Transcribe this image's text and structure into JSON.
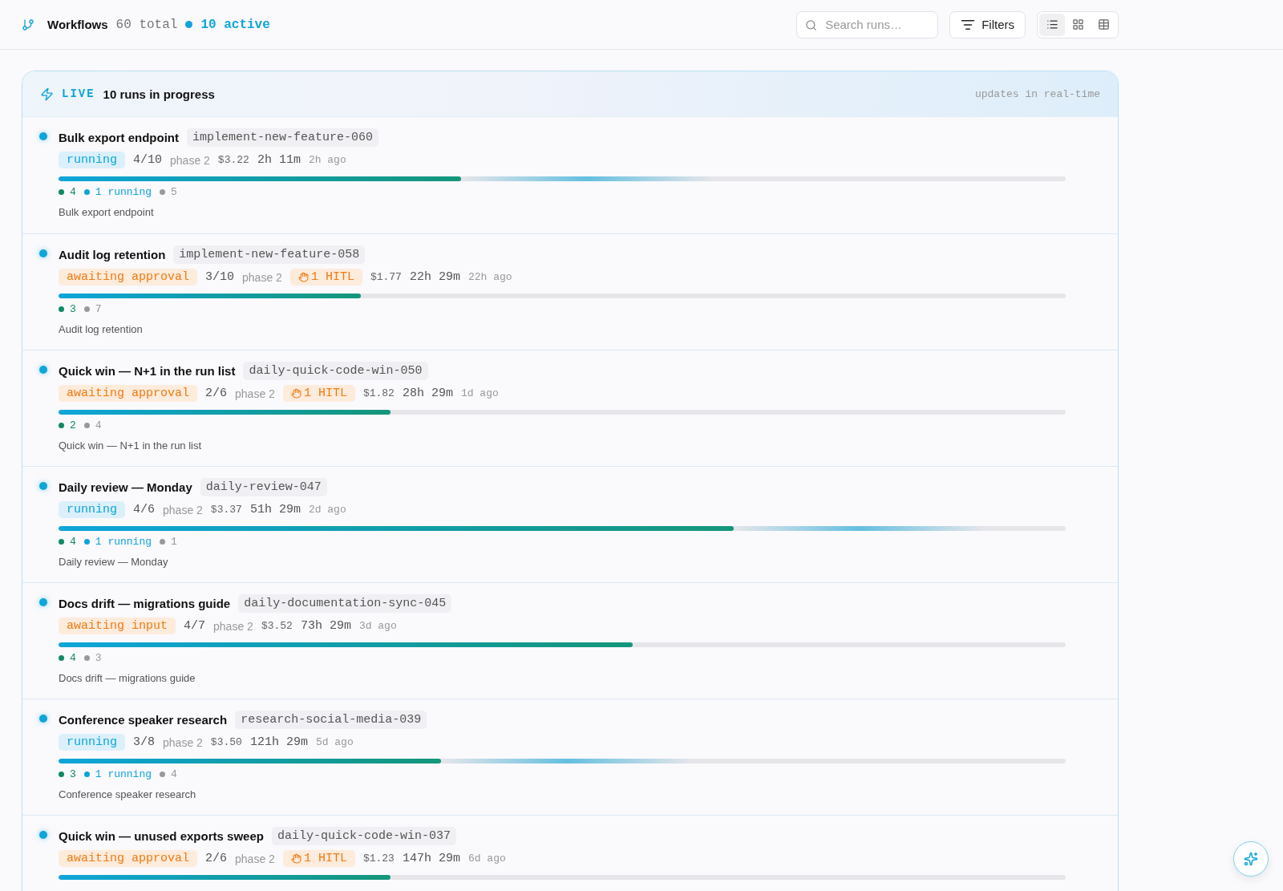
{
  "header": {
    "title": "Workflows",
    "total": "60 total",
    "active": "10 active"
  },
  "search": {
    "placeholder": "Search runs…"
  },
  "filters_button": "Filters",
  "view_toggle": [
    {
      "kind": "list",
      "selected": true
    },
    {
      "kind": "grid",
      "selected": false
    },
    {
      "kind": "table",
      "selected": false
    }
  ],
  "live_panel": {
    "badge": "LIVE",
    "title": "10 runs in progress",
    "note": "updates in real-time",
    "runs": [
      {
        "title": "Bulk export endpoint",
        "slug": "implement-new-feature-060",
        "status": {
          "kind": "running",
          "label": "running"
        },
        "steps": "4/10",
        "phase": "phase 2",
        "cost": "$3.22",
        "duration": "2h 11m",
        "age": "2h ago",
        "level": 0.4,
        "counts": [
          {
            "kind": "done",
            "label": "4"
          },
          {
            "kind": "running",
            "label": "1 running"
          },
          {
            "kind": "pending",
            "label": "5"
          }
        ],
        "description": "Bulk export endpoint"
      },
      {
        "title": "Audit log retention",
        "slug": "implement-new-feature-058",
        "status": {
          "kind": "awaiting",
          "label": "awaiting approval"
        },
        "steps": "3/10",
        "phase": "phase 2",
        "hitl": "1 HITL",
        "cost": "$1.77",
        "duration": "22h 29m",
        "age": "22h ago",
        "level": 0.3,
        "counts": [
          {
            "kind": "done",
            "label": "3"
          },
          {
            "kind": "pending",
            "label": "7"
          }
        ],
        "description": "Audit log retention"
      },
      {
        "title": "Quick win — N+1 in the run list",
        "slug": "daily-quick-code-win-050",
        "status": {
          "kind": "awaiting",
          "label": "awaiting approval"
        },
        "steps": "2/6",
        "phase": "phase 2",
        "hitl": "1 HITL",
        "cost": "$1.82",
        "duration": "28h 29m",
        "age": "1d ago",
        "level": 0.33,
        "counts": [
          {
            "kind": "done",
            "label": "2"
          },
          {
            "kind": "pending",
            "label": "4"
          }
        ],
        "description": "Quick win — N+1 in the run list"
      },
      {
        "title": "Daily review — Monday",
        "slug": "daily-review-047",
        "status": {
          "kind": "running",
          "label": "running"
        },
        "steps": "4/6",
        "phase": "phase 2",
        "cost": "$3.37",
        "duration": "51h 29m",
        "age": "2d ago",
        "level": 0.67,
        "counts": [
          {
            "kind": "done",
            "label": "4"
          },
          {
            "kind": "running",
            "label": "1 running"
          },
          {
            "kind": "pending",
            "label": "1"
          }
        ],
        "description": "Daily review — Monday"
      },
      {
        "title": "Docs drift — migrations guide",
        "slug": "daily-documentation-sync-045",
        "status": {
          "kind": "awaiting",
          "label": "awaiting input"
        },
        "steps": "4/7",
        "phase": "phase 2",
        "cost": "$3.52",
        "duration": "73h 29m",
        "age": "3d ago",
        "level": 0.57,
        "counts": [
          {
            "kind": "done",
            "label": "4"
          },
          {
            "kind": "pending",
            "label": "3"
          }
        ],
        "description": "Docs drift — migrations guide"
      },
      {
        "title": "Conference speaker research",
        "slug": "research-social-media-039",
        "status": {
          "kind": "running",
          "label": "running"
        },
        "steps": "3/8",
        "phase": "phase 2",
        "cost": "$3.50",
        "duration": "121h 29m",
        "age": "5d ago",
        "level": 0.38,
        "counts": [
          {
            "kind": "done",
            "label": "3"
          },
          {
            "kind": "running",
            "label": "1 running"
          },
          {
            "kind": "pending",
            "label": "4"
          }
        ],
        "description": "Conference speaker research"
      },
      {
        "title": "Quick win — unused exports sweep",
        "slug": "daily-quick-code-win-037",
        "status": {
          "kind": "awaiting",
          "label": "awaiting approval"
        },
        "steps": "2/6",
        "phase": "phase 2",
        "hitl": "1 HITL",
        "cost": "$1.23",
        "duration": "147h 29m",
        "age": "6d ago",
        "level": 0.33
      }
    ]
  }
}
